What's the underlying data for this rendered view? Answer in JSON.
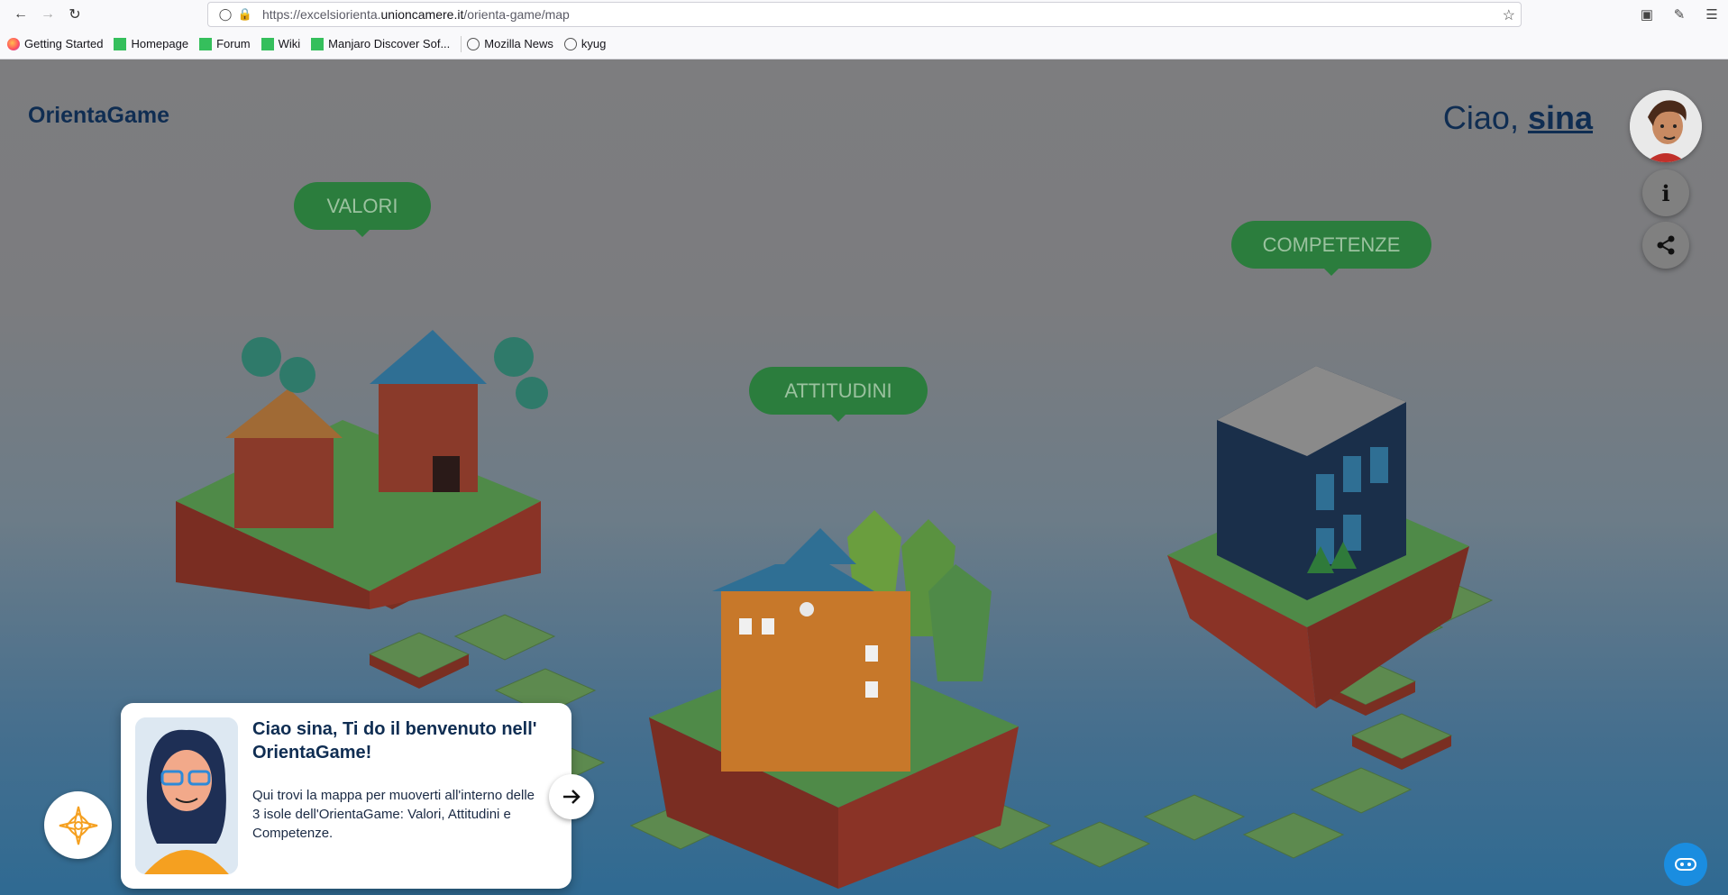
{
  "browser": {
    "url_prefix": "https://excelsiorienta.",
    "url_domain": "unioncamere.it",
    "url_path": "/orienta-game/map",
    "bookmarks": [
      {
        "label": "Getting Started",
        "icon": "firefox-icon"
      },
      {
        "label": "Homepage",
        "icon": "manjaro-icon"
      },
      {
        "label": "Forum",
        "icon": "manjaro-icon"
      },
      {
        "label": "Wiki",
        "icon": "manjaro-icon"
      },
      {
        "label": "Manjaro Discover Sof...",
        "icon": "manjaro-icon"
      },
      {
        "label": "Mozilla News",
        "icon": "globe-icon"
      },
      {
        "label": "kyug",
        "icon": "globe-icon"
      }
    ]
  },
  "header": {
    "logo": "OrientaGame",
    "greeting_prefix": "Ciao, ",
    "username": "sina"
  },
  "islands": {
    "valori": "VALORI",
    "attitudini": "ATTITUDINI",
    "competenze": "COMPETENZE"
  },
  "side_buttons": {
    "info": "i"
  },
  "welcome": {
    "title": "Ciao sina, Ti do il benvenuto nell' OrientaGame!",
    "body": "Qui trovi la mappa per muoverti all'interno delle 3 isole dell'OrientaGame: Valori, Attitudini e Competenze."
  },
  "colors": {
    "brand_navy": "#0f2d52",
    "pill_green": "#2b7d3d",
    "chat_blue": "#1a8de0"
  }
}
